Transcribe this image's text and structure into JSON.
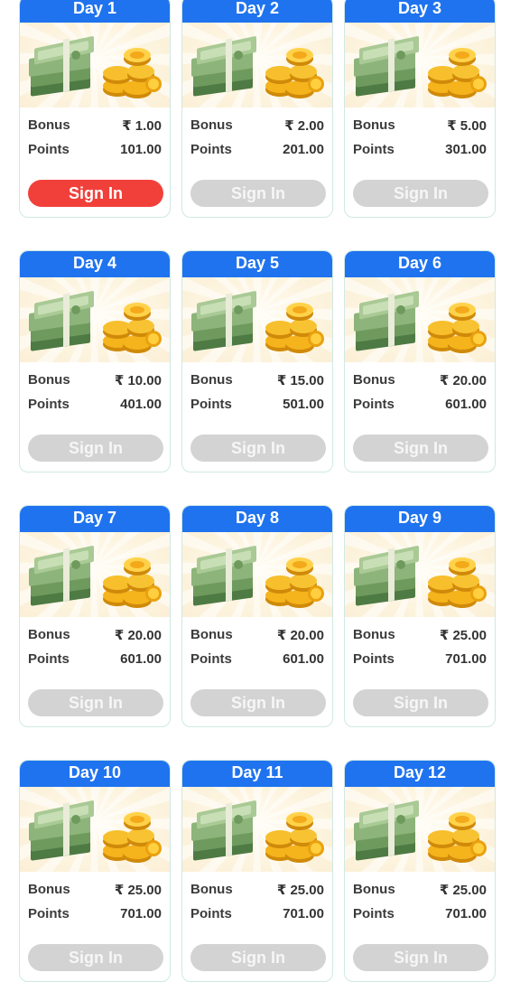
{
  "colors": {
    "header": "#1f73ef",
    "active_button": "#f1403a",
    "inactive_button": "#d3d3d3",
    "card_border": "#cfe9e4"
  },
  "icons": [
    "money-stack-icon",
    "gold-coins-icon"
  ],
  "cards": [
    {
      "day": "Day 1",
      "bonus_label": "Bonus",
      "bonus": "₹ 1.00",
      "points_label": "Points",
      "points": "101.00",
      "button": "Sign In",
      "active": true
    },
    {
      "day": "Day 2",
      "bonus_label": "Bonus",
      "bonus": "₹ 2.00",
      "points_label": "Points",
      "points": "201.00",
      "button": "Sign In",
      "active": false
    },
    {
      "day": "Day 3",
      "bonus_label": "Bonus",
      "bonus": "₹ 5.00",
      "points_label": "Points",
      "points": "301.00",
      "button": "Sign In",
      "active": false
    },
    {
      "day": "Day 4",
      "bonus_label": "Bonus",
      "bonus": "₹ 10.00",
      "points_label": "Points",
      "points": "401.00",
      "button": "Sign In",
      "active": false
    },
    {
      "day": "Day 5",
      "bonus_label": "Bonus",
      "bonus": "₹ 15.00",
      "points_label": "Points",
      "points": "501.00",
      "button": "Sign In",
      "active": false
    },
    {
      "day": "Day 6",
      "bonus_label": "Bonus",
      "bonus": "₹ 20.00",
      "points_label": "Points",
      "points": "601.00",
      "button": "Sign In",
      "active": false
    },
    {
      "day": "Day 7",
      "bonus_label": "Bonus",
      "bonus": "₹ 20.00",
      "points_label": "Points",
      "points": "601.00",
      "button": "Sign In",
      "active": false
    },
    {
      "day": "Day 8",
      "bonus_label": "Bonus",
      "bonus": "₹ 20.00",
      "points_label": "Points",
      "points": "601.00",
      "button": "Sign In",
      "active": false
    },
    {
      "day": "Day 9",
      "bonus_label": "Bonus",
      "bonus": "₹ 25.00",
      "points_label": "Points",
      "points": "701.00",
      "button": "Sign In",
      "active": false
    },
    {
      "day": "Day 10",
      "bonus_label": "Bonus",
      "bonus": "₹ 25.00",
      "points_label": "Points",
      "points": "701.00",
      "button": "Sign In",
      "active": false
    },
    {
      "day": "Day 11",
      "bonus_label": "Bonus",
      "bonus": "₹ 25.00",
      "points_label": "Points",
      "points": "701.00",
      "button": "Sign In",
      "active": false
    },
    {
      "day": "Day 12",
      "bonus_label": "Bonus",
      "bonus": "₹ 25.00",
      "points_label": "Points",
      "points": "701.00",
      "button": "Sign In",
      "active": false
    }
  ]
}
